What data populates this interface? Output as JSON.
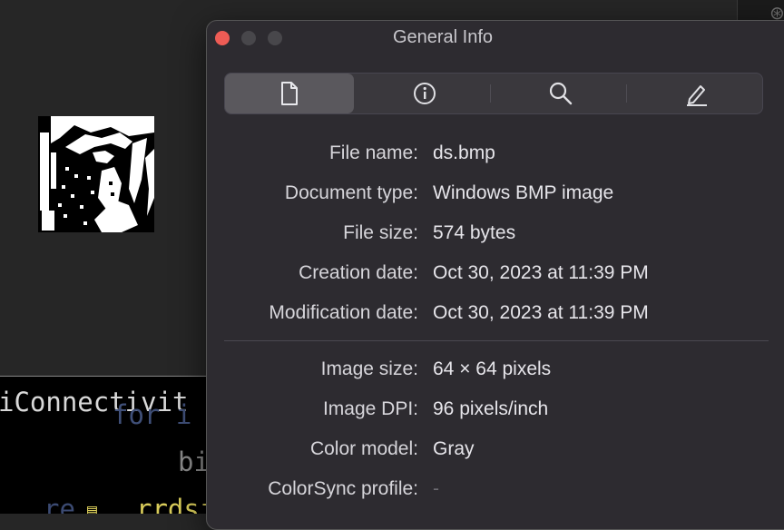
{
  "panel": {
    "title": "General Info",
    "tabs": [
      {
        "icon": "document-icon",
        "selected": true
      },
      {
        "icon": "info-icon",
        "selected": false
      },
      {
        "icon": "search-icon",
        "selected": false
      },
      {
        "icon": "pencil-icon",
        "selected": false
      }
    ],
    "file_fields": [
      {
        "label": "File name:",
        "value": "ds.bmp"
      },
      {
        "label": "Document type:",
        "value": "Windows BMP image"
      },
      {
        "label": "File size:",
        "value": "574 bytes"
      },
      {
        "label": "Creation date:",
        "value": "Oct 30, 2023 at 11:39 PM"
      },
      {
        "label": "Modification date:",
        "value": "Oct 30, 2023 at 11:39 PM"
      }
    ],
    "image_fields": [
      {
        "label": "Image size:",
        "value": "64 × 64 pixels"
      },
      {
        "label": "Image DPI:",
        "value": "96 pixels/inch"
      },
      {
        "label": "Color model:",
        "value": "Gray"
      },
      {
        "label": "ColorSync profile:",
        "value": "-"
      }
    ]
  },
  "terminal": {
    "line1": "iConnectivit",
    "line2": "for i",
    "line3": "bi",
    "line4": "re",
    "line5": "rrdsib"
  },
  "colors": {
    "close": "#ee5c55",
    "panel_bg": "#2d2b30",
    "selected_tab": "#5a585d"
  }
}
